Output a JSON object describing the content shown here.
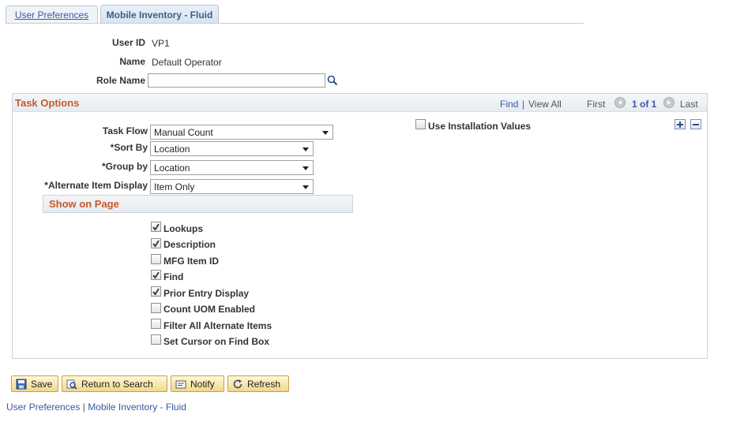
{
  "tabs": [
    {
      "label": "User Preferences",
      "active": false
    },
    {
      "label": "Mobile Inventory - Fluid",
      "active": true
    }
  ],
  "header": {
    "user_id_label": "User ID",
    "user_id_value": "VP1",
    "name_label": "Name",
    "name_value": "Default Operator",
    "role_name_label": "Role Name",
    "role_name_value": ""
  },
  "task_options": {
    "title": "Task Options",
    "nav": {
      "find": "Find",
      "separator": "|",
      "view_all": "View All",
      "first": "First",
      "range": "1 of 1",
      "last": "Last"
    },
    "use_installation_values": {
      "label": "Use Installation Values",
      "checked": false
    },
    "fields": {
      "task_flow_label": "Task Flow",
      "task_flow_value": "Manual Count",
      "sort_by_label": "*Sort By",
      "sort_by_value": "Location",
      "group_by_label": "*Group by",
      "group_by_value": "Location",
      "alt_item_label": "*Alternate Item Display",
      "alt_item_value": "Item Only"
    },
    "show_on_page": {
      "title": "Show on Page",
      "items": [
        {
          "label": "Lookups",
          "checked": true
        },
        {
          "label": "Description",
          "checked": true
        },
        {
          "label": "MFG Item ID",
          "checked": false
        },
        {
          "label": "Find",
          "checked": true
        },
        {
          "label": "Prior Entry Display",
          "checked": true
        },
        {
          "label": "Count UOM Enabled",
          "checked": false
        },
        {
          "label": "Filter All Alternate Items",
          "checked": false
        },
        {
          "label": "Set Cursor on Find Box",
          "checked": false
        }
      ]
    }
  },
  "buttons": {
    "save": "Save",
    "return_to_search": "Return to Search",
    "notify": "Notify",
    "refresh": "Refresh"
  },
  "footer": {
    "link1": "User Preferences",
    "separator": "|",
    "link2": "Mobile Inventory - Fluid"
  },
  "colors": {
    "section_title": "#c8582a",
    "link": "#3a56a7",
    "button_bg": "#f1d88a"
  }
}
